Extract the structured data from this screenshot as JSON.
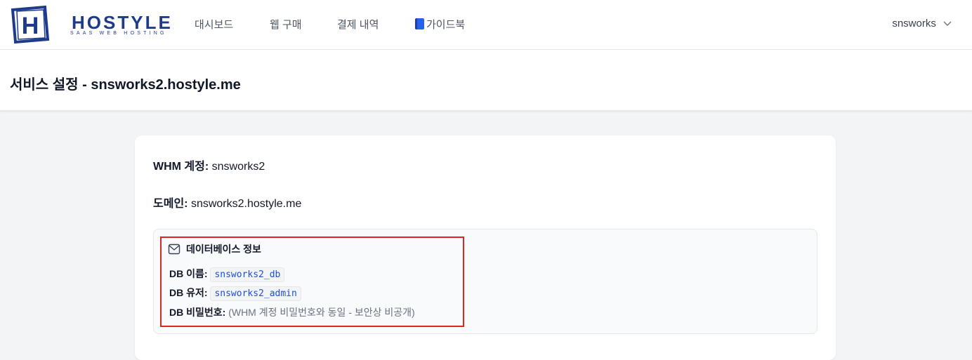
{
  "brand": {
    "name": "HOSTYLE",
    "tagline": "SAAS WEB HOSTING",
    "logo_letter": "H",
    "color": "#1e3a8a"
  },
  "nav": {
    "items": [
      {
        "label": "대시보드"
      },
      {
        "label": "웹 구매"
      },
      {
        "label": "결제 내역"
      },
      {
        "label": "가이드북",
        "icon": "book-icon"
      }
    ],
    "user": "snsworks"
  },
  "header": {
    "title": "서비스 설정 - snsworks2.hostyle.me"
  },
  "account": {
    "whm_label": "WHM 계정:",
    "whm_value": "snsworks2",
    "domain_label": "도메인:",
    "domain_value": "snsworks2.hostyle.me"
  },
  "database": {
    "title": "데이터베이스 정보",
    "icon": "mail-icon",
    "name_label": "DB 이름:",
    "name_value": "snsworks2_db",
    "user_label": "DB 유저:",
    "user_value": "snsworks2_admin",
    "password_label": "DB 비밀번호:",
    "password_value": "(WHM 계정 비밀번호와 동일 - 보안상 비공개)",
    "highlight_color": "#dc2626"
  }
}
